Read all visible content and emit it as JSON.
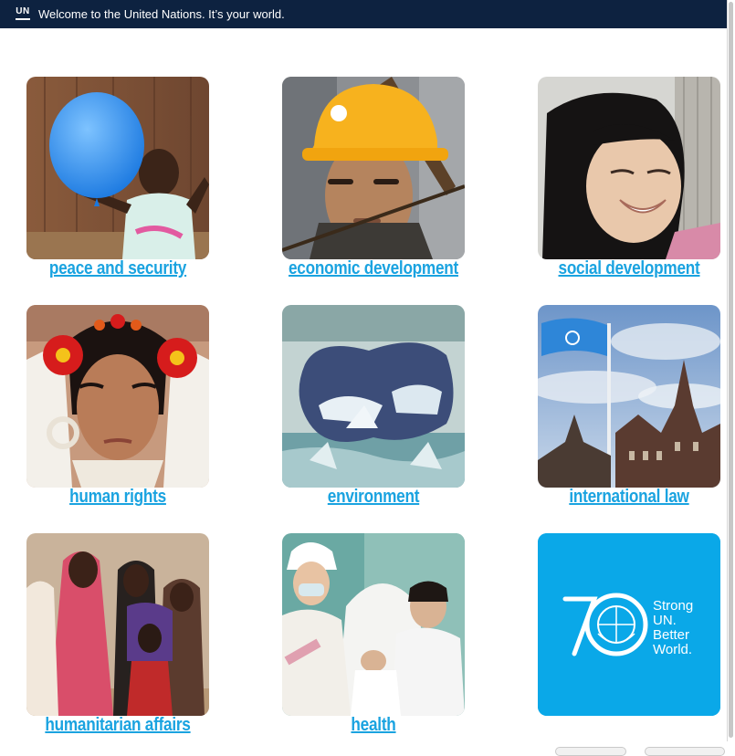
{
  "topbar": {
    "logo_text": "UN",
    "welcome": "Welcome to the United Nations. It’s your world."
  },
  "tiles": [
    {
      "label": "peace and security",
      "icon": "photo-child-balloon"
    },
    {
      "label": "economic development",
      "icon": "photo-worker-helmet"
    },
    {
      "label": "social development",
      "icon": "photo-smiling-girl"
    },
    {
      "label": "human rights",
      "icon": "photo-woman-flowers"
    },
    {
      "label": "environment",
      "icon": "photo-ice-hole"
    },
    {
      "label": "international law",
      "icon": "photo-un-flag-palace"
    },
    {
      "label": "humanitarian affairs",
      "icon": "photo-refugee-children"
    },
    {
      "label": "health",
      "icon": "photo-nurse-vaccination"
    },
    {
      "label": "",
      "icon": "un70-logo"
    }
  ],
  "un70": {
    "number": "70",
    "line1": "Strong",
    "line2": "UN.",
    "line3": "Better",
    "line4": "World."
  },
  "colors": {
    "topbar": "#0d2240",
    "link": "#1aa3e0",
    "un70_bg": "#0aa8e8"
  }
}
